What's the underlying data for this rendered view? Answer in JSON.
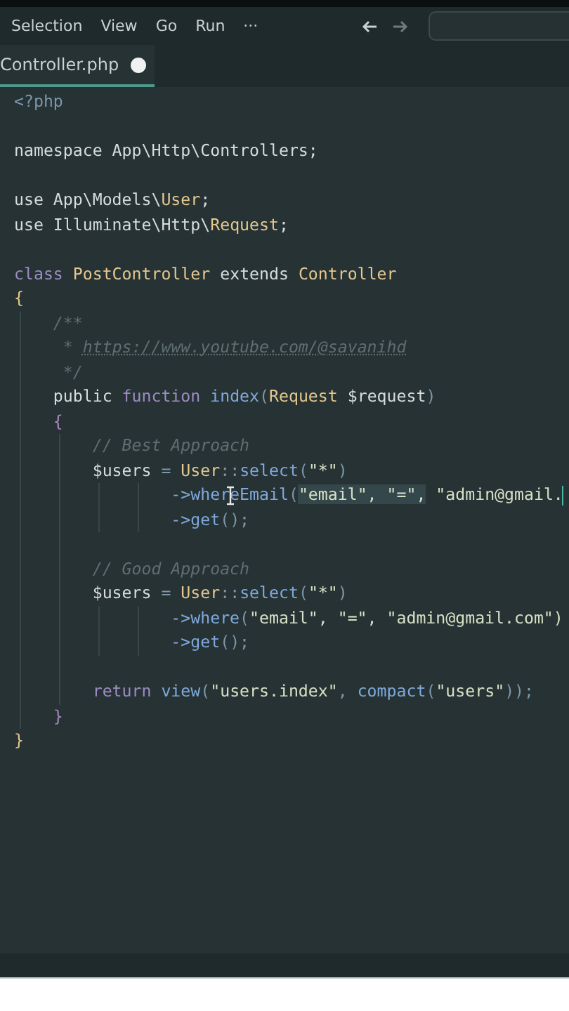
{
  "menu": [
    {
      "label": "Selection"
    },
    {
      "label": "View"
    },
    {
      "label": "Go"
    },
    {
      "label": "Run"
    },
    {
      "label": "···"
    }
  ],
  "tabs": [
    {
      "label": "Controller.php",
      "selected": true,
      "unsaved": true
    }
  ],
  "lines": [
    {
      "kind": "code",
      "tokens": [
        {
          "kind": "punct",
          "text": "<?php"
        }
      ]
    },
    {
      "kind": "blank"
    },
    {
      "kind": "code",
      "tokens": [
        {
          "kind": "plain",
          "text": "namespace App\\Http\\Controllers;"
        }
      ]
    },
    {
      "kind": "blank"
    },
    {
      "kind": "code",
      "tokens": [
        {
          "kind": "plain",
          "text": "use App\\Models\\"
        },
        {
          "kind": "class",
          "text": "User"
        },
        {
          "kind": "plain",
          "text": ";"
        }
      ]
    },
    {
      "kind": "code",
      "tokens": [
        {
          "kind": "plain",
          "text": "use Illuminate\\Http\\"
        },
        {
          "kind": "class",
          "text": "Request"
        },
        {
          "kind": "plain",
          "text": ";"
        }
      ]
    },
    {
      "kind": "blank"
    },
    {
      "kind": "code",
      "tokens": [
        {
          "kind": "keyword",
          "text": "class "
        },
        {
          "kind": "class",
          "text": "PostController"
        },
        {
          "kind": "plain",
          "text": " extends "
        },
        {
          "kind": "class",
          "text": "Controller"
        }
      ]
    },
    {
      "kind": "code",
      "tokens": [
        {
          "kind": "brace1",
          "text": "{"
        }
      ]
    },
    {
      "kind": "code",
      "tokens": [
        {
          "kind": "comment",
          "text": "    /**"
        }
      ]
    },
    {
      "kind": "code",
      "tokens": [
        {
          "kind": "comment",
          "text": "     * "
        },
        {
          "kind": "link",
          "text": "https://www.youtube.com/@savanihd"
        }
      ]
    },
    {
      "kind": "code",
      "tokens": [
        {
          "kind": "comment",
          "text": "     */"
        }
      ]
    },
    {
      "kind": "code",
      "tokens": [
        {
          "kind": "plain",
          "text": "    public "
        },
        {
          "kind": "keyword",
          "text": "function "
        },
        {
          "kind": "function",
          "text": "index"
        },
        {
          "kind": "punct",
          "text": "("
        },
        {
          "kind": "class",
          "text": "Request"
        },
        {
          "kind": "plain",
          "text": " $request"
        },
        {
          "kind": "punct",
          "text": ")"
        }
      ]
    },
    {
      "kind": "code",
      "tokens": [
        {
          "kind": "brace2",
          "text": "    {"
        }
      ]
    },
    {
      "kind": "code",
      "tokens": [
        {
          "kind": "comment",
          "text": "        // Best Approach"
        }
      ]
    },
    {
      "kind": "code",
      "tokens": [
        {
          "kind": "plain",
          "text": "        $users "
        },
        {
          "kind": "punct",
          "text": "= "
        },
        {
          "kind": "class",
          "text": "User"
        },
        {
          "kind": "punct",
          "text": "::"
        },
        {
          "kind": "function",
          "text": "select"
        },
        {
          "kind": "punct",
          "text": "("
        },
        {
          "kind": "string",
          "text": "\"*\""
        },
        {
          "kind": "punct",
          "text": ")"
        }
      ]
    },
    {
      "kind": "code",
      "tokens": [
        {
          "kind": "function",
          "text": "                ->whereEmail",
          "selected": false
        },
        {
          "kind": "punct",
          "text": "(",
          "selected": false
        },
        {
          "kind": "string",
          "text": "\"email\", \"=\",",
          "selected": true
        },
        {
          "kind": "string",
          "text": " \"admin@gmail.",
          "selected": false
        }
      ],
      "cursor": true
    },
    {
      "kind": "code",
      "tokens": [
        {
          "kind": "function",
          "text": "                ->get"
        },
        {
          "kind": "punct",
          "text": "();"
        }
      ]
    },
    {
      "kind": "blank"
    },
    {
      "kind": "code",
      "tokens": [
        {
          "kind": "comment",
          "text": "        // Good Approach"
        }
      ]
    },
    {
      "kind": "code",
      "tokens": [
        {
          "kind": "plain",
          "text": "        $users "
        },
        {
          "kind": "punct",
          "text": "= "
        },
        {
          "kind": "class",
          "text": "User"
        },
        {
          "kind": "punct",
          "text": "::"
        },
        {
          "kind": "function",
          "text": "select"
        },
        {
          "kind": "punct",
          "text": "("
        },
        {
          "kind": "string",
          "text": "\"*\""
        },
        {
          "kind": "punct",
          "text": ")"
        }
      ]
    },
    {
      "kind": "code",
      "tokens": [
        {
          "kind": "function",
          "text": "                ->where"
        },
        {
          "kind": "punct",
          "text": "("
        },
        {
          "kind": "string",
          "text": "\"email\", \"=\", \"admin@gmail.com\")"
        }
      ]
    },
    {
      "kind": "code",
      "tokens": [
        {
          "kind": "function",
          "text": "                ->get"
        },
        {
          "kind": "punct",
          "text": "();"
        }
      ]
    },
    {
      "kind": "blank"
    },
    {
      "kind": "code",
      "tokens": [
        {
          "kind": "keyword",
          "text": "        return "
        },
        {
          "kind": "function",
          "text": "view"
        },
        {
          "kind": "punct",
          "text": "("
        },
        {
          "kind": "string",
          "text": "\"users.index\""
        },
        {
          "kind": "punct",
          "text": ", "
        },
        {
          "kind": "function",
          "text": "compact"
        },
        {
          "kind": "punct",
          "text": "("
        },
        {
          "kind": "string",
          "text": "\"users\""
        },
        {
          "kind": "punct",
          "text": "));"
        }
      ]
    },
    {
      "kind": "code",
      "tokens": [
        {
          "kind": "brace2",
          "text": "    }"
        }
      ]
    },
    {
      "kind": "code",
      "tokens": [
        {
          "kind": "brace1",
          "text": "}"
        }
      ]
    }
  ]
}
